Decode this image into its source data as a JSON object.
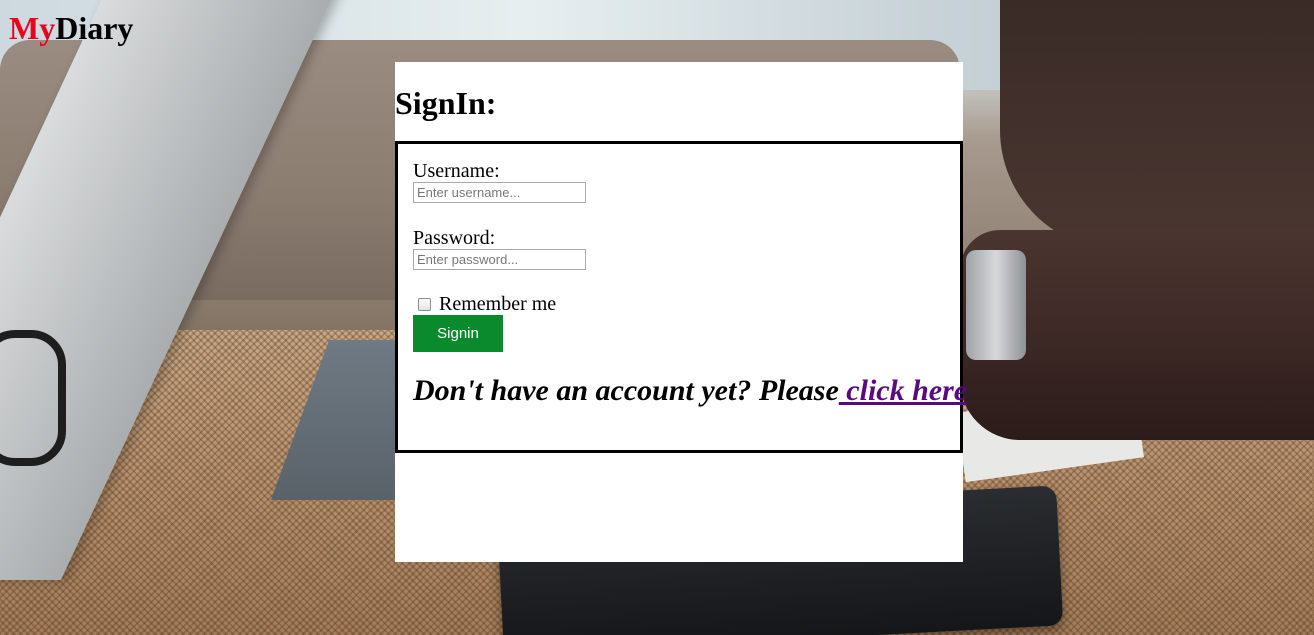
{
  "brand": {
    "part1": "My",
    "part2": "Diary",
    "part1_color": "#e8001c",
    "part2_color": "#000000"
  },
  "signin": {
    "title": "SignIn:",
    "username_label": "Username:",
    "username_placeholder": "Enter username...",
    "username_value": "",
    "password_label": "Password:",
    "password_placeholder": "Enter password...",
    "password_value": "",
    "remember_label": "Remember me",
    "remember_checked": false,
    "submit_label": "Signin",
    "submit_color": "#0a8a2c",
    "signup_prompt": "Don't have an account yet? Please",
    "signup_link": " click here",
    "link_color": "#5a0a80"
  }
}
